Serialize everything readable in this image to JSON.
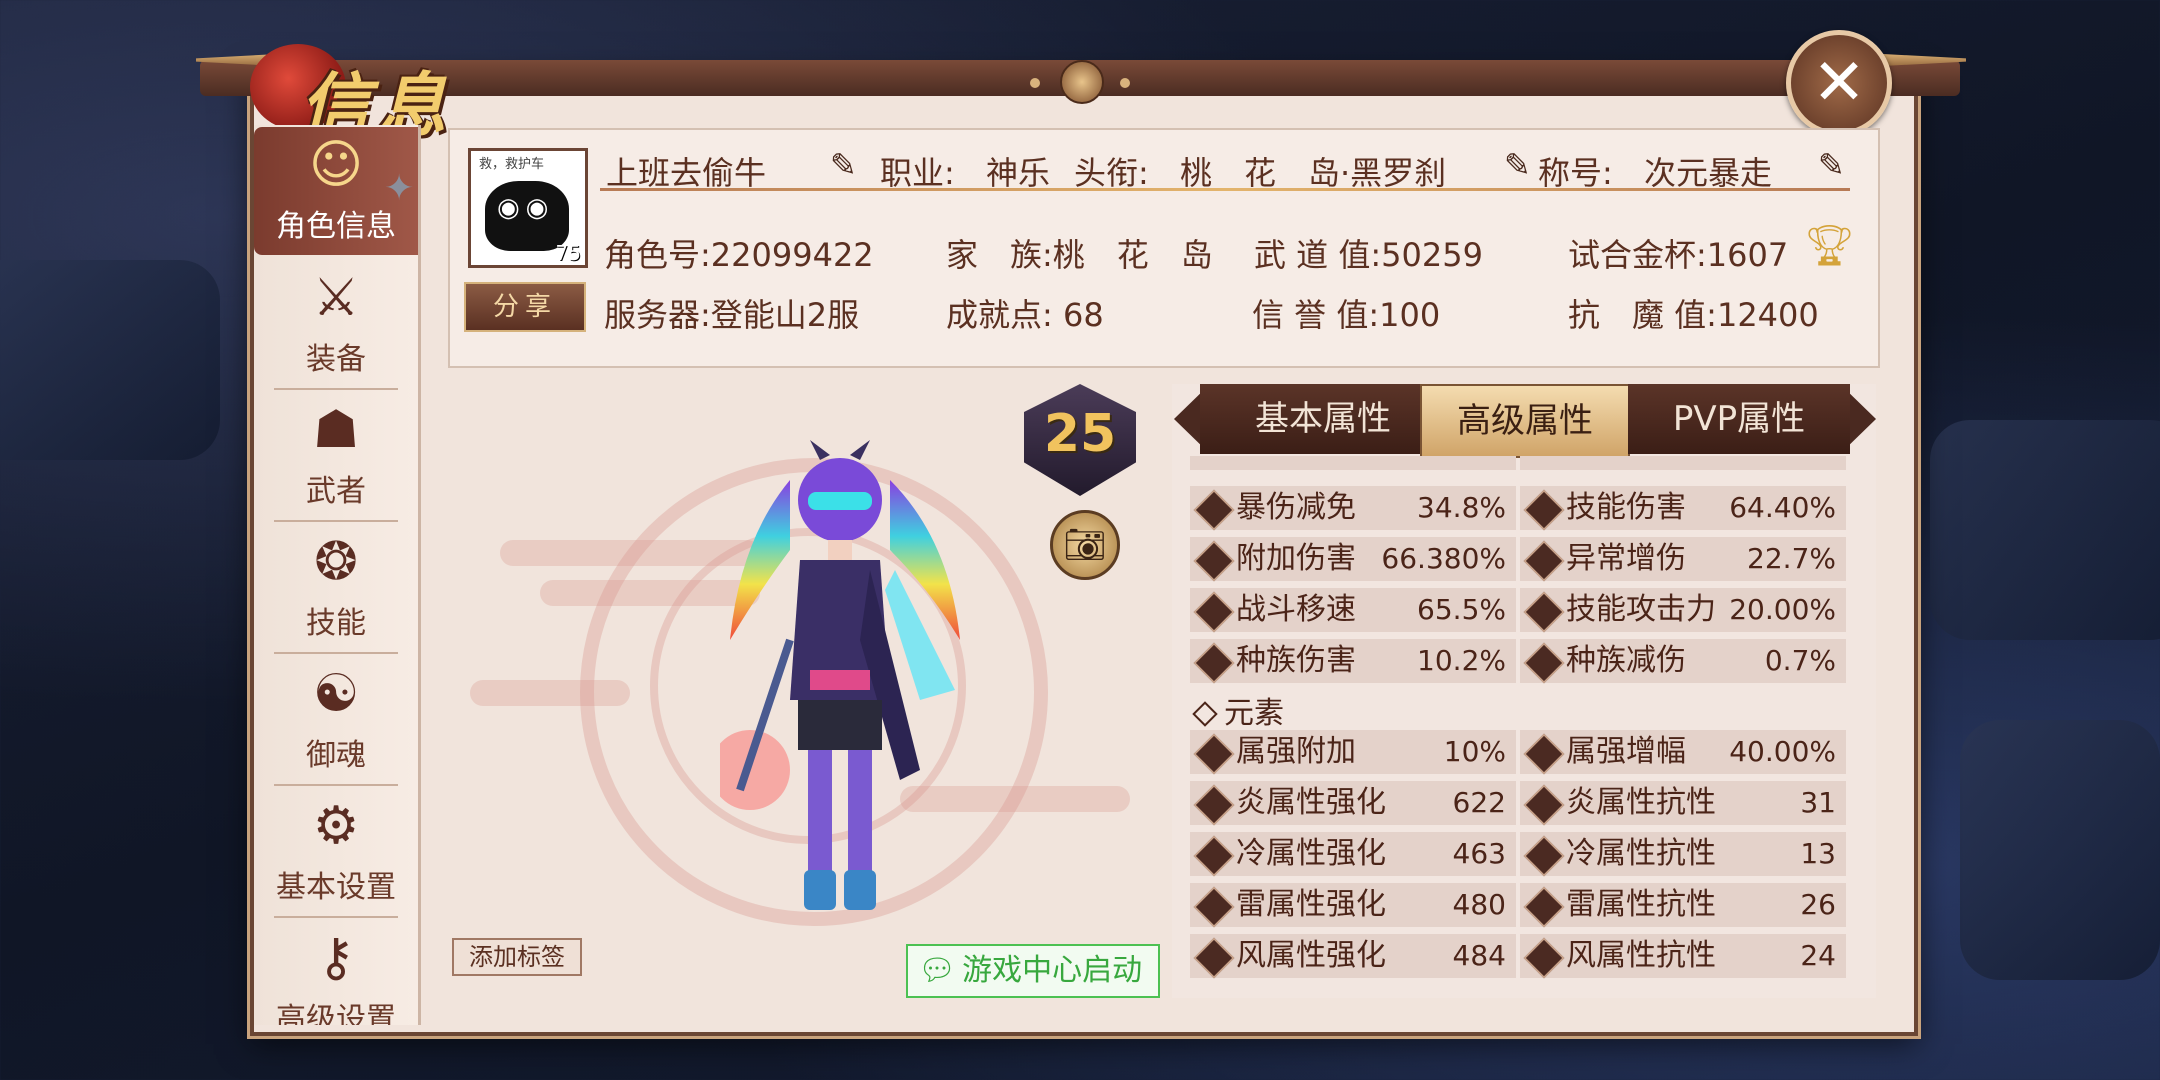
{
  "title": "信息",
  "close_label": "✕",
  "sidebar": {
    "items": [
      {
        "label": "角色信息",
        "icon": "character-info-icon"
      },
      {
        "label": "装备",
        "icon": "equipment-icon"
      },
      {
        "label": "武者",
        "icon": "warrior-icon"
      },
      {
        "label": "技能",
        "icon": "skill-icon"
      },
      {
        "label": "御魂",
        "icon": "soul-icon"
      },
      {
        "label": "基本设置",
        "icon": "gear-icon"
      },
      {
        "label": "高级设置",
        "icon": "key-gear-icon"
      }
    ]
  },
  "profile": {
    "name": "上班去偷牛",
    "avatar_text": "救，救护车",
    "level": "75",
    "class_label": "职业:",
    "class_value": "神乐",
    "rank_title_label": "头衔:",
    "rank_title_value": "桃　花　岛·黑罗刹",
    "nickname_label": "称号:",
    "nickname_value": "次元暴走",
    "role_id": "角色号:22099422",
    "family": "家　族:桃　花　岛",
    "martial": "武 道 值:50259",
    "trial_cup": "试合金杯:1607",
    "server": "服务器:登能山2服",
    "achievement": "成就点: 68",
    "reputation": "信 誉 值:100",
    "demon_resist": "抗　魔 值:12400",
    "share_label": "分享"
  },
  "rank_badge": "25",
  "add_tag_label": "添加标签",
  "wechat_label": "游戏中心启动",
  "tabs": [
    "基本属性",
    "高级属性",
    "PVP属性"
  ],
  "active_tab": 1,
  "attributes": [
    [
      {
        "name": "暴伤减免",
        "value": "34.8%"
      },
      {
        "name": "技能伤害",
        "value": "64.40%"
      }
    ],
    [
      {
        "name": "附加伤害",
        "value": "66.380%"
      },
      {
        "name": "异常增伤",
        "value": "22.7%"
      }
    ],
    [
      {
        "name": "战斗移速",
        "value": "65.5%"
      },
      {
        "name": "技能攻击力",
        "value": "20.00%"
      }
    ],
    [
      {
        "name": "种族伤害",
        "value": "10.2%"
      },
      {
        "name": "种族减伤",
        "value": "0.7%"
      }
    ]
  ],
  "element_header": "元素",
  "element_attributes": [
    [
      {
        "name": "属强附加",
        "value": "10%"
      },
      {
        "name": "属强增幅",
        "value": "40.00%"
      }
    ],
    [
      {
        "name": "炎属性强化",
        "value": "622"
      },
      {
        "name": "炎属性抗性",
        "value": "31"
      }
    ],
    [
      {
        "name": "冷属性强化",
        "value": "463"
      },
      {
        "name": "冷属性抗性",
        "value": "13"
      }
    ],
    [
      {
        "name": "雷属性强化",
        "value": "480"
      },
      {
        "name": "雷属性抗性",
        "value": "26"
      }
    ],
    [
      {
        "name": "风属性强化",
        "value": "484"
      },
      {
        "name": "风属性抗性",
        "value": "24"
      }
    ]
  ],
  "colors": {
    "accent": "#7b3b2e",
    "gold": "#f1c35e",
    "panel": "#f1e4dc",
    "wechat": "#38a83e"
  }
}
